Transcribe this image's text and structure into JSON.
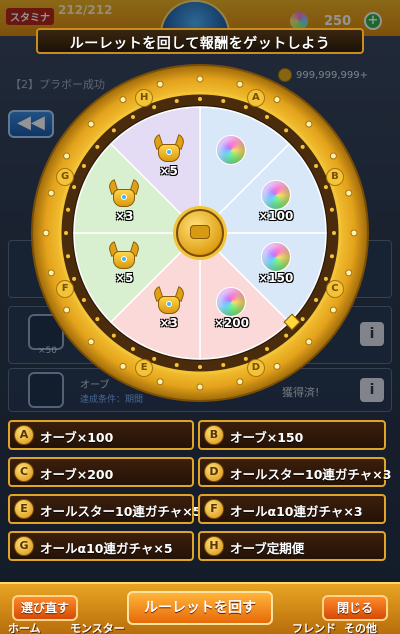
{
  "background": {
    "stamina_label": "スタミナ",
    "stamina_value": "212/212",
    "gem_count": "250",
    "gem_plus": "+",
    "quest_title": "【2】プラボー成功",
    "coin_value": "999,999,999+",
    "back_arrow": "◀◀",
    "card_count": "×50",
    "card_title": "オーブ",
    "card_condition": "達成条件：期間",
    "claimed_text": "獲得済!",
    "info_icon": "i"
  },
  "title": "ルーレットを回して報酬をゲットしよう",
  "wheel": {
    "letters": [
      "A",
      "B",
      "C",
      "D",
      "E",
      "F",
      "G",
      "H"
    ],
    "prizes": [
      {
        "kind": "orb",
        "qty": ""
      },
      {
        "kind": "orb",
        "qty": "×100"
      },
      {
        "kind": "orb",
        "qty": "×150"
      },
      {
        "kind": "orb",
        "qty": "×200"
      },
      {
        "kind": "helm",
        "qty": "×3"
      },
      {
        "kind": "helm",
        "qty": "×5"
      },
      {
        "kind": "helm",
        "qty": "×3"
      },
      {
        "kind": "helm",
        "qty": "×5"
      }
    ],
    "segment_colors": [
      "#d9e8f8",
      "#d9e8f8",
      "#d9e8f8",
      "#fbd9d9",
      "#fbd9d9",
      "#d8f0d0",
      "#d8f0d0",
      "#e4dcf4"
    ]
  },
  "prize_list": [
    {
      "letter": "A",
      "label": "オーブ×100"
    },
    {
      "letter": "B",
      "label": "オーブ×150"
    },
    {
      "letter": "C",
      "label": "オーブ×200"
    },
    {
      "letter": "D",
      "label": "オールスター10連ガチャ×3"
    },
    {
      "letter": "E",
      "label": "オールスター10連ガチャ×5"
    },
    {
      "letter": "F",
      "label": "オールα10連ガチャ×3"
    },
    {
      "letter": "G",
      "label": "オールα10連ガチャ×5"
    },
    {
      "letter": "H",
      "label": "オーブ定期便"
    }
  ],
  "buttons": {
    "reselect": "選び直す",
    "spin": "ルーレットを回す",
    "close": "閉じる"
  },
  "nav": {
    "home": "ホーム",
    "monster": "モンスター",
    "friend": "フレンド",
    "other": "その他"
  },
  "colors": {
    "accent_gold": "#e0a528",
    "panel_dark": "#2a1508",
    "spin_button": "#e66a08"
  }
}
